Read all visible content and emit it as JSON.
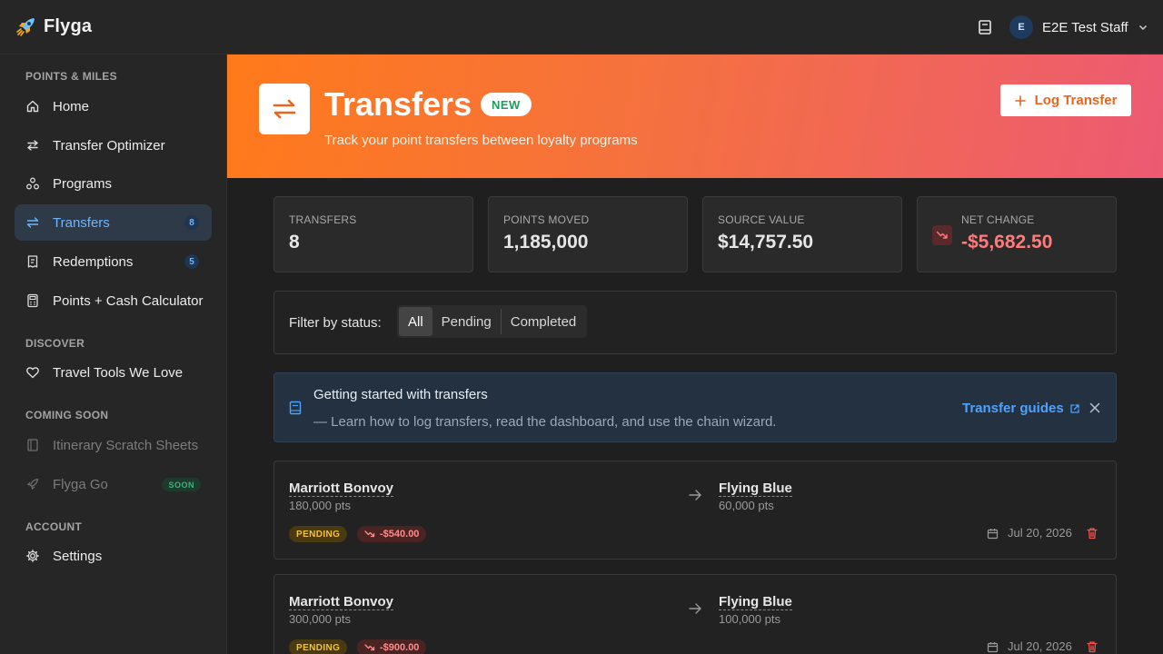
{
  "app": {
    "name": "Flyga"
  },
  "user": {
    "initial": "E",
    "name": "E2E Test Staff"
  },
  "sidebar": {
    "sections": {
      "points": "POINTS & MILES",
      "discover": "DISCOVER",
      "coming_soon": "COMING SOON",
      "account": "ACCOUNT"
    },
    "items": {
      "home": "Home",
      "optimizer": "Transfer Optimizer",
      "programs": "Programs",
      "transfers": "Transfers",
      "transfers_count": "8",
      "redemptions": "Redemptions",
      "redemptions_count": "5",
      "calculator": "Points + Cash Calculator",
      "travel_tools": "Travel Tools We Love",
      "itinerary": "Itinerary Scratch Sheets",
      "flyga_go": "Flyga Go",
      "soon_badge": "SOON",
      "settings": "Settings"
    }
  },
  "hero": {
    "title": "Transfers",
    "badge": "NEW",
    "subtitle": "Track your point transfers between loyalty programs",
    "action": "Log Transfer"
  },
  "stats": [
    {
      "label": "TRANSFERS",
      "value": "8"
    },
    {
      "label": "POINTS MOVED",
      "value": "1,185,000"
    },
    {
      "label": "SOURCE VALUE",
      "value": "$14,757.50"
    },
    {
      "label": "NET CHANGE",
      "value": "-$5,682.50"
    }
  ],
  "filter": {
    "label": "Filter by status:",
    "options": [
      "All",
      "Pending",
      "Completed"
    ],
    "selected": "All"
  },
  "banner": {
    "title": "Getting started with transfers",
    "description": "— Learn how to log transfers, read the dashboard, and use the chain wizard.",
    "link": "Transfer guides"
  },
  "transfers": [
    {
      "from_program": "Marriott Bonvoy",
      "from_points": "180,000 pts",
      "to_program": "Flying Blue",
      "to_points": "60,000 pts",
      "status": "PENDING",
      "change": "-$540.00",
      "date": "Jul 20, 2026"
    },
    {
      "from_program": "Marriott Bonvoy",
      "from_points": "300,000 pts",
      "to_program": "Flying Blue",
      "to_points": "100,000 pts",
      "status": "PENDING",
      "change": "-$900.00",
      "date": "Jul 20, 2026"
    }
  ],
  "colors": {
    "accent": "#4ca3ff",
    "hero_gradient_start": "#ff7a1a",
    "hero_gradient_end": "#ec5a73",
    "negative": "#ff7b7b",
    "pending": "#f3c13a"
  }
}
